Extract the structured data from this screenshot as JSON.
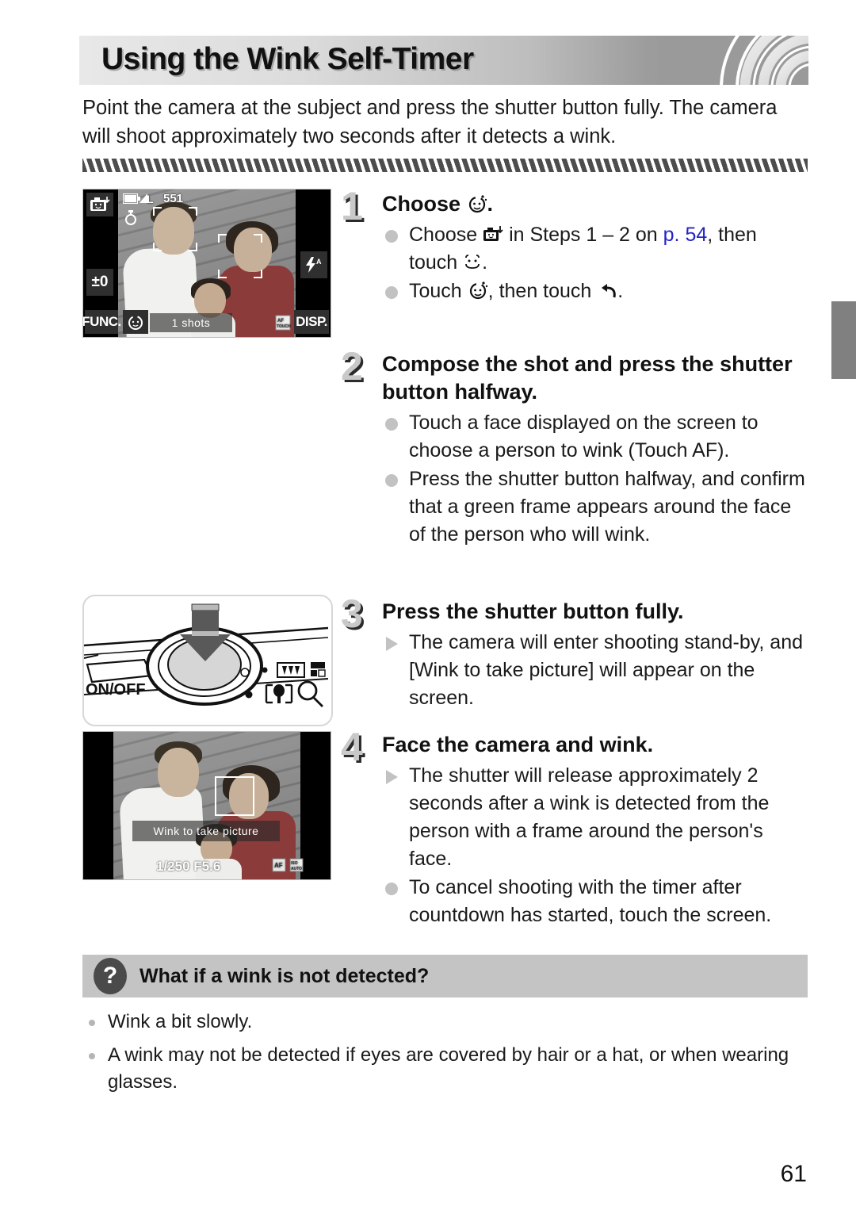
{
  "header": {
    "title": "Using the Wink Self-Timer",
    "decoration": "lens-arcs-graphic"
  },
  "intro": "Point the camera at the subject and press the shutter button fully. The camera will shoot approximately two seconds after it detects a wink.",
  "steps": [
    {
      "number": "1",
      "title_prefix": "Choose",
      "title_icon": "wink-self-timer-icon",
      "title_suffix": ".",
      "bullets": [
        {
          "type": "dot",
          "parts": [
            {
              "kind": "text",
              "value": "Choose "
            },
            {
              "kind": "icon",
              "value": "smart-shutter-icon"
            },
            {
              "kind": "text",
              "value": " in Steps 1 – 2 on "
            },
            {
              "kind": "link",
              "value": "p. 54"
            },
            {
              "kind": "text",
              "value": ", then touch "
            },
            {
              "kind": "icon",
              "value": "wink-face-icon"
            },
            {
              "kind": "text",
              "value": "."
            }
          ],
          "plain": "Choose  in Steps 1 – 2 on p. 54, then touch ."
        },
        {
          "type": "dot",
          "parts": [
            {
              "kind": "text",
              "value": "Touch "
            },
            {
              "kind": "icon",
              "value": "wink-self-timer-icon"
            },
            {
              "kind": "text",
              "value": ", then touch "
            },
            {
              "kind": "icon",
              "value": "back-arrow-icon"
            },
            {
              "kind": "text",
              "value": "."
            }
          ],
          "plain": "Touch , then touch ."
        }
      ]
    },
    {
      "number": "2",
      "title": "Compose the shot and press the shutter button halfway.",
      "bullets": [
        {
          "type": "dot",
          "text": "Touch a face displayed on the screen to choose a person to wink (Touch AF)."
        },
        {
          "type": "dot",
          "text": "Press the shutter button halfway, and confirm that a green frame appears around the face of the person who will wink."
        }
      ]
    },
    {
      "number": "3",
      "title": "Press the shutter button fully.",
      "bullets": [
        {
          "type": "triangle",
          "text": "The camera will enter shooting stand-by, and [Wink to take picture] will appear on the screen."
        }
      ]
    },
    {
      "number": "4",
      "title": "Face the camera and wink.",
      "bullets": [
        {
          "type": "triangle",
          "text": "The shutter will release approximately 2 seconds after a wink is detected from the person with a frame around the person's face."
        },
        {
          "type": "dot",
          "text": "To cancel shooting with the timer after countdown has started, touch the screen."
        }
      ]
    }
  ],
  "figures": {
    "lcd_step1": {
      "name": "camera-lcd-face-detection",
      "icons": {
        "mode": "smart-shutter-icon",
        "battery": "battery-icon",
        "quality": "L",
        "shots_remaining": "551",
        "self_timer_status": "self-timer-icon",
        "exposure": "±0",
        "func_label": "FUNC.",
        "disp_label": "DISP.",
        "flash": "flash-auto-icon"
      },
      "banner_text": "1 shots"
    },
    "camera_top": {
      "name": "camera-top-shutter-button",
      "onoff_label": "ON/OFF",
      "icons": [
        "zoom-wide-icon",
        "zoom-tele-icon",
        "macro-icon",
        "magnify-icon",
        "press-down-arrow"
      ]
    },
    "lcd_step4": {
      "name": "camera-lcd-wink-standby",
      "banner_text": "Wink to take picture",
      "info_left": "1/250  F5.6"
    }
  },
  "qa": {
    "icon": "?",
    "title": "What if a wink is not detected?",
    "items": [
      "Wink a bit slowly.",
      "A wink may not be detected if eyes are covered by hair or a hat, or when wearing glasses."
    ]
  },
  "page_number": "61",
  "colors": {
    "link": "#2323c8",
    "bullet": "#c2c2c2",
    "banner": "#c4c4c4",
    "stripe": "#4d4d4d",
    "tab": "#808080"
  }
}
